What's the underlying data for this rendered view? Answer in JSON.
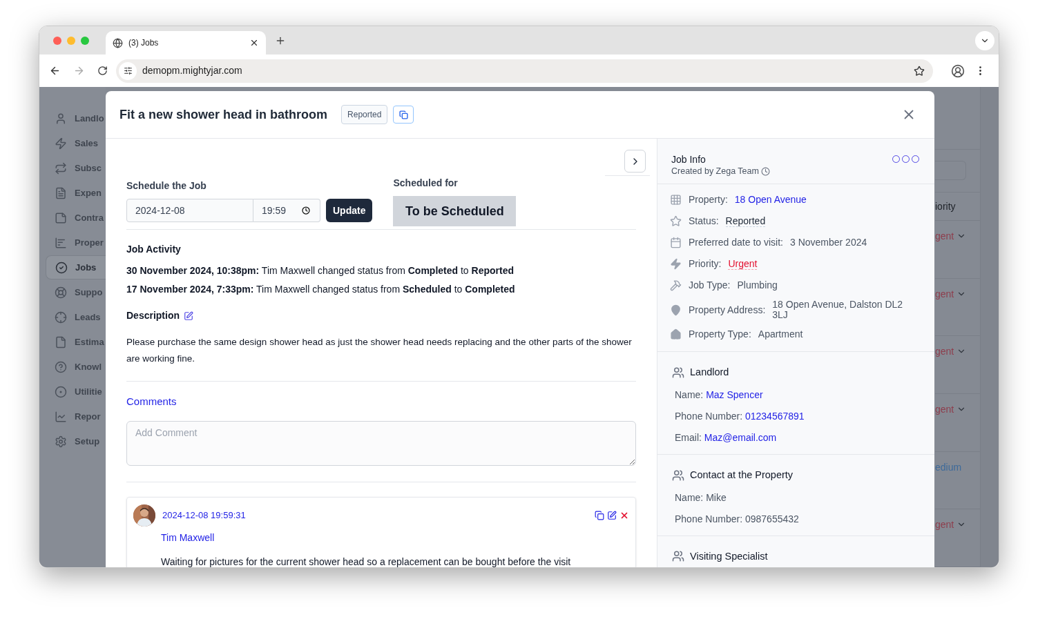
{
  "browser": {
    "tab_title": "(3) Jobs",
    "url": "demopm.mightyjar.com"
  },
  "background": {
    "sidebar": [
      {
        "label": "Landlo",
        "selected": false
      },
      {
        "label": "Sales",
        "selected": false
      },
      {
        "label": "Subsc",
        "selected": false
      },
      {
        "label": "Expen",
        "selected": false
      },
      {
        "label": "Contra",
        "selected": false
      },
      {
        "label": "Proper",
        "selected": false
      },
      {
        "label": "Jobs",
        "selected": true
      },
      {
        "label": "Suppo",
        "selected": false
      },
      {
        "label": "Leads",
        "selected": false
      },
      {
        "label": "Estima",
        "selected": false
      },
      {
        "label": "Knowl",
        "selected": false
      },
      {
        "label": "Utilitie",
        "selected": false
      },
      {
        "label": "Repor",
        "selected": false
      },
      {
        "label": "Setup",
        "selected": false
      }
    ],
    "column_header": "iority",
    "column_cells": [
      {
        "text": "gent",
        "kind": "urgent"
      },
      {
        "text": "gent",
        "kind": "urgent"
      },
      {
        "text": "gent",
        "kind": "urgent"
      },
      {
        "text": "gent",
        "kind": "urgent"
      },
      {
        "text": "edium",
        "kind": "medium"
      },
      {
        "text": "gent",
        "kind": "urgent"
      }
    ]
  },
  "modal": {
    "title": "Fit a new shower head in bathroom",
    "status_badge": "Reported",
    "schedule": {
      "label": "Schedule the Job",
      "date": "2024-12-08",
      "time": "19:59",
      "button": "Update"
    },
    "scheduled_for": {
      "label": "Scheduled for",
      "value": "To be Scheduled"
    },
    "activity": {
      "heading": "Job Activity",
      "entries": [
        "**30 November 2024, 10:38pm:** Tim Maxwell changed status from **Completed** to **Reported**",
        "**17 November 2024, 7:33pm:** Tim Maxwell changed status from **Scheduled** to **Completed**"
      ]
    },
    "description": {
      "heading": "Description",
      "text": "Please purchase the same design shower head as just the shower head needs replacing and the other parts of the shower are working fine."
    },
    "comments": {
      "heading": "Comments",
      "placeholder": "Add Comment",
      "items": [
        {
          "timestamp": "2024-12-08 19:59:31",
          "author": "Tim Maxwell",
          "text": "Waiting for pictures for the current shower head so a replacement can be bought before the visit"
        }
      ]
    },
    "job_info": {
      "title": "Job Info",
      "created_by": "Created by Zega Team",
      "fields": [
        {
          "label": "Property:",
          "value": "18 Open Avenue",
          "kind": "link"
        },
        {
          "label": "Status:",
          "value": "Reported",
          "kind": "underlined"
        },
        {
          "label": "Preferred date to visit:",
          "value": "3 November 2024",
          "kind": "plain"
        },
        {
          "label": "Priority:",
          "value": "Urgent",
          "kind": "urgent"
        },
        {
          "label": "Job Type:",
          "value": "Plumbing",
          "kind": "plain"
        },
        {
          "label": "Property Address:",
          "value": "18 Open Avenue, Dalston DL2 3LJ",
          "kind": "plain"
        },
        {
          "label": "Property Type:",
          "value": "Apartment",
          "kind": "plain"
        }
      ]
    },
    "contacts": [
      {
        "title": "Landlord",
        "rows": [
          {
            "label": "Name:",
            "value": "Maz Spencer",
            "kind": "link"
          },
          {
            "label": "Phone Number:",
            "value": "01234567891",
            "kind": "link"
          },
          {
            "label": "Email:",
            "value": "Maz@email.com",
            "kind": "link"
          }
        ]
      },
      {
        "title": "Contact at the Property",
        "rows": [
          {
            "label": "Name:",
            "value": "Mike",
            "kind": "plain"
          },
          {
            "label": "Phone Number:",
            "value": "0987655432",
            "kind": "plain"
          }
        ]
      },
      {
        "title": "Visiting Specialist"
      }
    ]
  }
}
